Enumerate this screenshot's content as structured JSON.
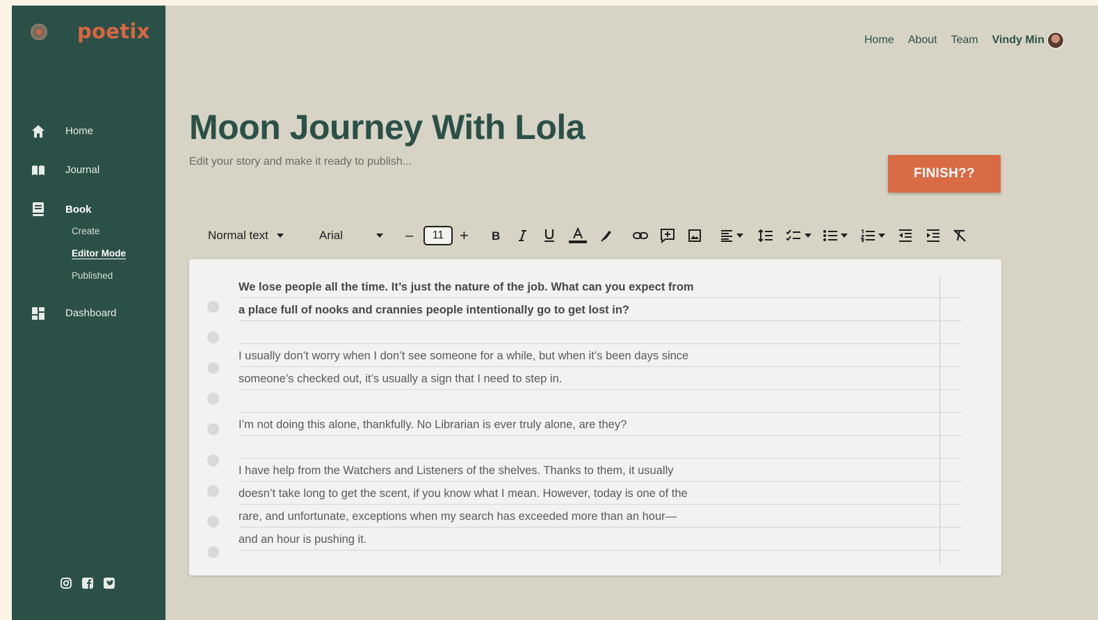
{
  "brand": {
    "name": "poetix"
  },
  "sidebar": {
    "items": [
      {
        "label": "Home",
        "icon": "home-icon"
      },
      {
        "label": "Journal",
        "icon": "journal-icon"
      },
      {
        "label": "Book",
        "icon": "book-icon"
      },
      {
        "label": "Dashboard",
        "icon": "dashboard-icon"
      }
    ],
    "book_sub": [
      "Create",
      "Editor Mode",
      "Published"
    ],
    "active_sub": "Editor Mode",
    "socials": [
      "instagram-icon",
      "facebook-icon",
      "twitter-icon"
    ]
  },
  "topnav": {
    "links": [
      "Home",
      "About",
      "Team"
    ],
    "user": "Vindy Min"
  },
  "header": {
    "title": "Moon Journey With Lola",
    "subtitle": "Edit your story and make it ready to publish...",
    "finish_label": "FINISH??"
  },
  "toolbar": {
    "style": "Normal text",
    "font": "Arial",
    "size": "11",
    "minus": "–",
    "plus": "+"
  },
  "editor": {
    "lines": [
      {
        "text": "We lose people all the time. It’s just the nature of the job. What can you expect from",
        "bold": true
      },
      {
        "text": "a place full of nooks and crannies people intentionally go to get lost in?",
        "bold": true
      },
      {
        "text": "",
        "bold": false
      },
      {
        "text": "I usually don’t worry when I don’t see someone for a while, but when it’s been days since",
        "bold": false
      },
      {
        "text": "someone’s checked out, it’s usually a sign that I need to step in.",
        "bold": false
      },
      {
        "text": "",
        "bold": false
      },
      {
        "text": "I’m not doing this alone, thankfully. No Librarian is ever truly alone, are they?",
        "bold": false
      },
      {
        "text": "",
        "bold": false
      },
      {
        "text": "I have help from the Watchers and Listeners of the shelves. Thanks to them, it usually",
        "bold": false
      },
      {
        "text": "doesn’t take long to get the scent, if you know what I mean. However, today is one of the",
        "bold": false
      },
      {
        "text": "rare, and unfortunate, exceptions when my search has exceeded more than an hour—",
        "bold": false
      },
      {
        "text": "and an hour is pushing it.",
        "bold": false
      }
    ]
  },
  "colors": {
    "sidebar": "#2b5048",
    "accent": "#d86a44",
    "background": "#d7d4c5"
  }
}
